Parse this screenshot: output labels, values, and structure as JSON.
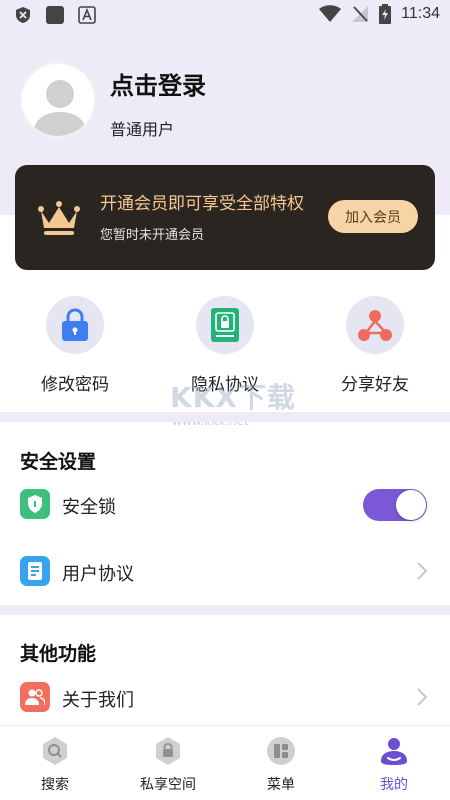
{
  "status_bar": {
    "time": "11:34"
  },
  "profile": {
    "login_text": "点击登录",
    "user_type": "普通用户"
  },
  "vip": {
    "title": "开通会员即可享受全部特权",
    "subtitle": "您暂时未开通会员",
    "button": "加入会员"
  },
  "quick_actions": [
    {
      "label": "修改密码",
      "icon": "lock-icon"
    },
    {
      "label": "隐私协议",
      "icon": "document-lock-icon"
    },
    {
      "label": "分享好友",
      "icon": "share-icon"
    }
  ],
  "watermark": {
    "text": "KKX下载",
    "url": "www.kkx.net"
  },
  "security": {
    "title": "安全设置",
    "lock_label": "安全锁",
    "lock_enabled": true,
    "agreement_label": "用户协议"
  },
  "other": {
    "title": "其他功能",
    "about_label": "关于我们"
  },
  "nav": [
    {
      "label": "搜索",
      "icon": "search-icon"
    },
    {
      "label": "私享空间",
      "icon": "private-space-icon"
    },
    {
      "label": "菜单",
      "icon": "menu-grid-icon"
    },
    {
      "label": "我的",
      "icon": "profile-icon",
      "active": true
    }
  ],
  "colors": {
    "accent": "#7a58d6",
    "vip_gold": "#f4c892",
    "vip_card": "#2a2521",
    "bg_lavender": "#eeeaf7"
  }
}
